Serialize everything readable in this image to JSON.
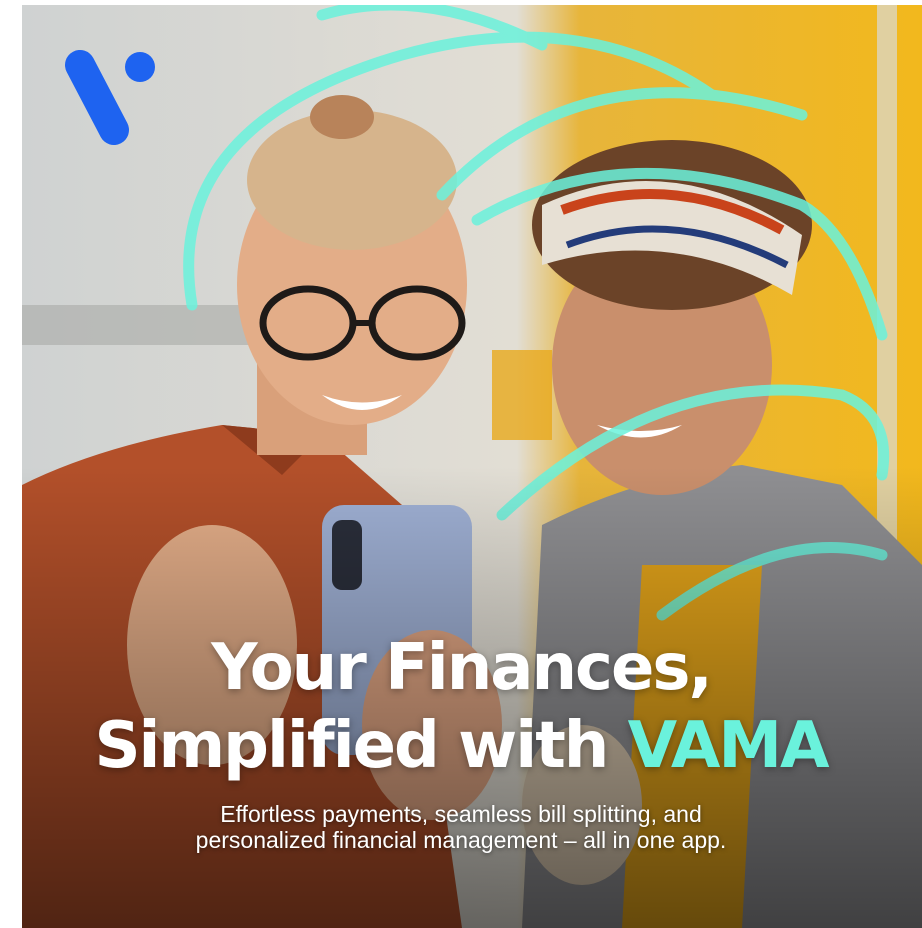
{
  "headline": {
    "line1": "Your Finances,",
    "line2_prefix": "Simplified with",
    "line2_brand": "VAMA"
  },
  "subtitle": {
    "line1": "Effortless payments, seamless bill splitting, and",
    "line2": "personalized financial management – all in one app."
  },
  "colors": {
    "brand_accent": "#6af2dc",
    "logo_blue": "#1e63f0",
    "headline_text": "#ffffff"
  },
  "logo": {
    "icon": "vama-logo-icon"
  }
}
